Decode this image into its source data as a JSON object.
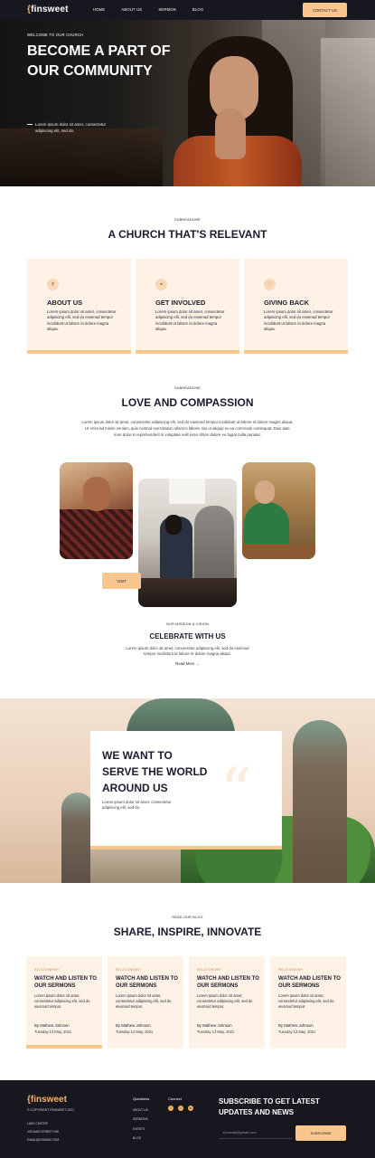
{
  "nav": {
    "logo_brace": "{",
    "logo_text": "finsweet",
    "links": [
      "HOME",
      "ABOUT US",
      "SERMON",
      "BLOG"
    ],
    "cta": "CONTACT US"
  },
  "hero": {
    "eyebrow": "WELCOME TO OUR CHURCH",
    "title": "BECOME A PART OF OUR COMMUNITY",
    "description": "Lorem ipsum dolor sit amet, consectetur adipiscing elit, sed do."
  },
  "relevant": {
    "eyebrow": "SUBHEADLINE",
    "title": "A CHURCH THAT'S RELEVANT",
    "cards": [
      {
        "icon": "church-icon",
        "glyph": "✝",
        "title": "ABOUT US",
        "text": "Lorem ipsum dolor sit amet, consectetur adipiscing elit, sed do eiusmod tempor incididunt ut labore et dolore magna aliqua."
      },
      {
        "icon": "handshake-icon",
        "glyph": "⚭",
        "title": "GET INVOLVED",
        "text": "Lorem ipsum dolor sit amet, consectetur adipiscing elit, sed do eiusmod tempor incididunt ut labore et dolore magna aliqua."
      },
      {
        "icon": "donate-icon",
        "glyph": "♡",
        "title": "GIVING BACK",
        "text": "Lorem ipsum dolor sit amet, consectetur adipiscing elit, sed do eiusmod tempor incididunt ut labore et dolore magna aliqua."
      }
    ]
  },
  "love": {
    "eyebrow": "SUBHEADLINE",
    "title": "LOVE AND COMPASSION",
    "text": "Lorem ipsum dolor sit amet, consectetur adipiscing elit, sed do eiusmod tempor incididunt ut labore et dolore magna aliqua. Ut enim ad minim veniam, quis nostrud exercitation ullamco laboris nisi ut aliquip ex ea commodo consequat. Duis aute irure dolor in reprehenderit in voluptate velit esse cillum dolore eu fugiat nulla pariatur.",
    "visit_button": "VISIT",
    "celebrate_eyebrow": "OUR MISSION & VISION",
    "celebrate_title": "CELEBRATE WITH US",
    "celebrate_text": "Lorem ipsum dolor sit amet, consectetur adipiscing elit, sed do eiusmod tempor incididunt ut labore et dolore magna aliqua.",
    "read_more": "Read More  →"
  },
  "serve": {
    "title": "WE WANT TO SERVE THE WORLD AROUND US",
    "text": "Lorem ipsum dolor sit amet, consectetur adipiscing elit, sed do.",
    "quote_glyph": "“"
  },
  "blog": {
    "eyebrow": "READ OUR BLOG",
    "title": "SHARE, INSPIRE, INNOVATE",
    "posts": [
      {
        "tag": "RELATIONSHIP",
        "title": "WATCH AND LISTEN TO OUR SERMONS",
        "text": "Lorem ipsum dolor sit amet, consectetur adipiscing elit, sed do eiusmod tempor.",
        "author": "By Mathew Johnson",
        "date": "Tuesday 13 May, 2021"
      },
      {
        "tag": "RELATIONSHIP",
        "title": "WATCH AND LISTEN TO OUR SERMONS",
        "text": "Lorem ipsum dolor sit amet, consectetur adipiscing elit, sed do eiusmod tempor.",
        "author": "By Mathew Johnson",
        "date": "Tuesday 13 May, 2021"
      },
      {
        "tag": "RELATIONSHIP",
        "title": "WATCH AND LISTEN TO OUR SERMONS",
        "text": "Lorem ipsum dolor sit amet, consectetur adipiscing elit, sed do eiusmod tempor.",
        "author": "By Mathew Johnson",
        "date": "Tuesday 13 May, 2021"
      },
      {
        "tag": "RELATIONSHIP",
        "title": "WATCH AND LISTEN TO OUR SERMONS",
        "text": "Lorem ipsum dolor sit amet, consectetur adipiscing elit, sed do eiusmod tempor.",
        "author": "By Mathew Johnson",
        "date": "Tuesday 13 May, 2021"
      }
    ]
  },
  "footer": {
    "logo": "{finsweet",
    "copyright": "© COPYRIGHT FINSWEET 2021",
    "address": [
      "LAKE CENTER",
      "435 MAIN STREET NW",
      "EMAIL@DOMAIN.COM"
    ],
    "quicklinks_head": "Quicklinks",
    "quicklinks": [
      "ABOUT US",
      "SERMONS",
      "EVENTS",
      "BLOG"
    ],
    "connect_head": "Connect",
    "socials": [
      {
        "icon": "facebook-icon",
        "glyph": "f"
      },
      {
        "icon": "twitter-icon",
        "glyph": "t"
      },
      {
        "icon": "linkedin-icon",
        "glyph": "in"
      }
    ],
    "subscribe_title": "SUBSCRIBE TO GET LATEST UPDATES AND NEWS",
    "email_placeholder": "Yourmail@gmail.com",
    "subscribe_button": "SUBSCRIBE"
  }
}
